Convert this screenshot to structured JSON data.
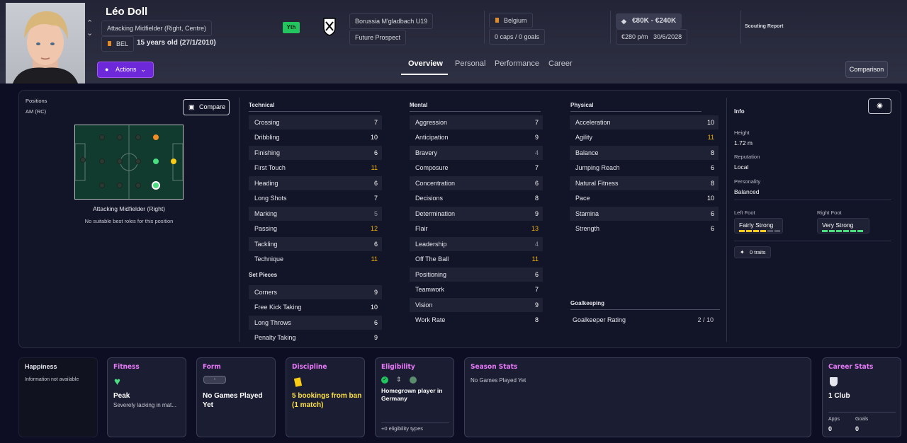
{
  "player": {
    "name": "Léo Doll",
    "position": "Attacking Midfielder (Right, Centre)",
    "nation_code": "BEL",
    "age": "15 years old (27/1/2010)",
    "youth_badge": "Yth",
    "club": "Borussia M'gladbach U19",
    "status": "Future Prospect",
    "country": "Belgium",
    "caps": "0 caps / 0 goals",
    "value": "€80K - €240K",
    "wage": "€280 p/m",
    "contract_end": "30/6/2028",
    "scouting": "Scouting Report",
    "actions": "Actions",
    "comparison": "Comparison"
  },
  "tabs": [
    "Overview",
    "Personal",
    "Performance",
    "Career"
  ],
  "positions": {
    "label": "Positions",
    "value": "AM (RC)",
    "compare": "Compare",
    "role": "Attacking Midfielder (Right)",
    "note": "No suitable best roles for this position"
  },
  "technical": {
    "title": "Technical",
    "rows": [
      [
        "Crossing",
        "7"
      ],
      [
        "Dribbling",
        "10"
      ],
      [
        "Finishing",
        "6"
      ],
      [
        "First Touch",
        "11"
      ],
      [
        "Heading",
        "6"
      ],
      [
        "Long Shots",
        "7"
      ],
      [
        "Marking",
        "5"
      ],
      [
        "Passing",
        "12"
      ],
      [
        "Tackling",
        "6"
      ],
      [
        "Technique",
        "11"
      ]
    ]
  },
  "setpieces": {
    "title": "Set Pieces",
    "rows": [
      [
        "Corners",
        "9"
      ],
      [
        "Free Kick Taking",
        "10"
      ],
      [
        "Long Throws",
        "6"
      ],
      [
        "Penalty Taking",
        "9"
      ]
    ]
  },
  "mental": {
    "title": "Mental",
    "rows": [
      [
        "Aggression",
        "7"
      ],
      [
        "Anticipation",
        "9"
      ],
      [
        "Bravery",
        "4"
      ],
      [
        "Composure",
        "7"
      ],
      [
        "Concentration",
        "6"
      ],
      [
        "Decisions",
        "8"
      ],
      [
        "Determination",
        "9"
      ],
      [
        "Flair",
        "13"
      ],
      [
        "Leadership",
        "4"
      ],
      [
        "Off The Ball",
        "11"
      ],
      [
        "Positioning",
        "6"
      ],
      [
        "Teamwork",
        "7"
      ],
      [
        "Vision",
        "9"
      ],
      [
        "Work Rate",
        "8"
      ]
    ]
  },
  "physical": {
    "title": "Physical",
    "rows": [
      [
        "Acceleration",
        "10"
      ],
      [
        "Agility",
        "11"
      ],
      [
        "Balance",
        "8"
      ],
      [
        "Jumping Reach",
        "6"
      ],
      [
        "Natural Fitness",
        "8"
      ],
      [
        "Pace",
        "10"
      ],
      [
        "Stamina",
        "6"
      ],
      [
        "Strength",
        "6"
      ]
    ]
  },
  "goalkeeping": {
    "title": "Goalkeeping",
    "label": "Goalkeeper Rating",
    "value": "2 / 10"
  },
  "info": {
    "title": "Info",
    "height_label": "Height",
    "height": "1.72 m",
    "rep_label": "Reputation",
    "rep": "Local",
    "pers_label": "Personality",
    "pers": "Balanced",
    "left_label": "Left Foot",
    "left": "Fairly Strong",
    "right_label": "Right Foot",
    "right": "Very Strong",
    "traits": "0 traits"
  },
  "cards": {
    "happiness": {
      "title": "Happiness",
      "text": "Information not available"
    },
    "fitness": {
      "title": "Fitness",
      "value": "Peak",
      "note": "Severely lacking in mat..."
    },
    "form": {
      "title": "Form",
      "badge": "-",
      "value": "No Games Played Yet"
    },
    "discipline": {
      "title": "Discipline",
      "value": "5 bookings from ban (1 match)"
    },
    "eligibility": {
      "title": "Eligibility",
      "value": "Homegrown player in Germany",
      "foot": "+0 eligibility types"
    },
    "season": {
      "title": "Season Stats",
      "text": "No Games Played Yet"
    },
    "career": {
      "title": "Career Stats",
      "clubs": "1 Club",
      "apps_label": "Apps",
      "apps": "0",
      "goals_label": "Goals",
      "goals": "0"
    }
  }
}
